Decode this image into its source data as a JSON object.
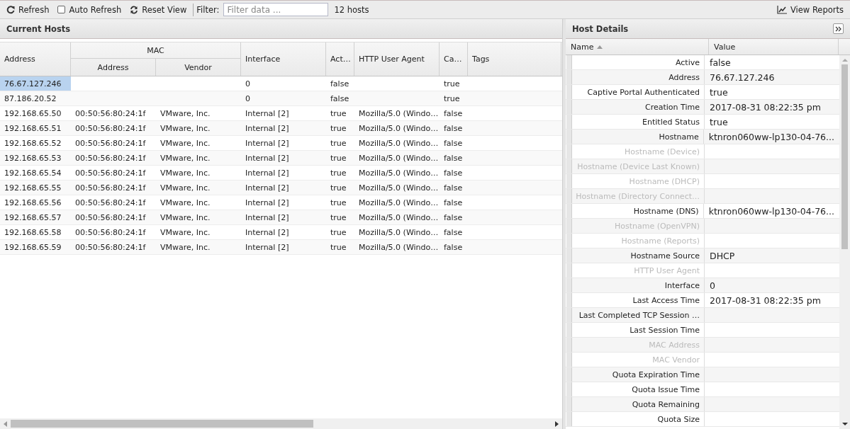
{
  "toolbar": {
    "refresh": "Refresh",
    "auto_refresh": {
      "label": "Auto Refresh",
      "checked": false
    },
    "reset_view": "Reset View",
    "filter_label": "Filter:",
    "filter": {
      "placeholder": "Filter data ..."
    },
    "count": "12 hosts",
    "view_reports": "View Reports"
  },
  "hosts_panel": {
    "title": "Current Hosts",
    "group_header": "MAC",
    "columns": [
      "Address",
      "Address",
      "Vendor",
      "Interface",
      "Act…",
      "HTTP User Agent",
      "Ca…",
      "Tags"
    ],
    "rows": [
      {
        "selected": true,
        "cells": [
          "76.67.127.246",
          "",
          "",
          "0",
          "false",
          "",
          "true",
          ""
        ]
      },
      {
        "selected": false,
        "cells": [
          "87.186.20.52",
          "",
          "",
          "0",
          "false",
          "",
          "true",
          ""
        ]
      },
      {
        "selected": false,
        "cells": [
          "192.168.65.50",
          "00:50:56:80:24:1f",
          "VMware, Inc.",
          "Internal [2]",
          "true",
          "Mozilla/5.0 (Windo…",
          "false",
          ""
        ]
      },
      {
        "selected": false,
        "cells": [
          "192.168.65.51",
          "00:50:56:80:24:1f",
          "VMware, Inc.",
          "Internal [2]",
          "true",
          "Mozilla/5.0 (Windo…",
          "false",
          ""
        ]
      },
      {
        "selected": false,
        "cells": [
          "192.168.65.52",
          "00:50:56:80:24:1f",
          "VMware, Inc.",
          "Internal [2]",
          "true",
          "Mozilla/5.0 (Windo…",
          "false",
          ""
        ]
      },
      {
        "selected": false,
        "cells": [
          "192.168.65.53",
          "00:50:56:80:24:1f",
          "VMware, Inc.",
          "Internal [2]",
          "true",
          "Mozilla/5.0 (Windo…",
          "false",
          ""
        ]
      },
      {
        "selected": false,
        "cells": [
          "192.168.65.54",
          "00:50:56:80:24:1f",
          "VMware, Inc.",
          "Internal [2]",
          "true",
          "Mozilla/5.0 (Windo…",
          "false",
          ""
        ]
      },
      {
        "selected": false,
        "cells": [
          "192.168.65.55",
          "00:50:56:80:24:1f",
          "VMware, Inc.",
          "Internal [2]",
          "true",
          "Mozilla/5.0 (Windo…",
          "false",
          ""
        ]
      },
      {
        "selected": false,
        "cells": [
          "192.168.65.56",
          "00:50:56:80:24:1f",
          "VMware, Inc.",
          "Internal [2]",
          "true",
          "Mozilla/5.0 (Windo…",
          "false",
          ""
        ]
      },
      {
        "selected": false,
        "cells": [
          "192.168.65.57",
          "00:50:56:80:24:1f",
          "VMware, Inc.",
          "Internal [2]",
          "true",
          "Mozilla/5.0 (Windo…",
          "false",
          ""
        ]
      },
      {
        "selected": false,
        "cells": [
          "192.168.65.58",
          "00:50:56:80:24:1f",
          "VMware, Inc.",
          "Internal [2]",
          "true",
          "Mozilla/5.0 (Windo…",
          "false",
          ""
        ]
      },
      {
        "selected": false,
        "cells": [
          "192.168.65.59",
          "00:50:56:80:24:1f",
          "VMware, Inc.",
          "Internal [2]",
          "true",
          "Mozilla/5.0 (Windo…",
          "false",
          ""
        ]
      }
    ]
  },
  "details_panel": {
    "title": "Host Details",
    "columns": [
      "Name",
      "Value"
    ],
    "rows": [
      {
        "name": "Active",
        "value": "false",
        "disabled": false
      },
      {
        "name": "Address",
        "value": "76.67.127.246",
        "disabled": false
      },
      {
        "name": "Captive Portal Authenticated",
        "value": "true",
        "disabled": false
      },
      {
        "name": "Creation Time",
        "value": "2017-08-31 08:22:35 pm",
        "disabled": false
      },
      {
        "name": "Entitled Status",
        "value": "true",
        "disabled": false
      },
      {
        "name": "Hostname",
        "value": "ktnron060ww-lp130-04-76...",
        "disabled": false
      },
      {
        "name": "Hostname (Device)",
        "disabled": true
      },
      {
        "name": "Hostname (Device Last Known)",
        "disabled": true
      },
      {
        "name": "Hostname (DHCP)",
        "disabled": true
      },
      {
        "name": "Hostname (Directory Connect…",
        "disabled": true
      },
      {
        "name": "Hostname (DNS)",
        "value": "ktnron060ww-lp130-04-76...",
        "disabled": false
      },
      {
        "name": "Hostname (OpenVPN)",
        "disabled": true
      },
      {
        "name": "Hostname (Reports)",
        "disabled": true
      },
      {
        "name": "Hostname Source",
        "value": "DHCP",
        "disabled": false
      },
      {
        "name": "HTTP User Agent",
        "disabled": true
      },
      {
        "name": "Interface",
        "value": "0",
        "disabled": false
      },
      {
        "name": "Last Access Time",
        "value": "2017-08-31 08:22:35 pm",
        "disabled": false
      },
      {
        "name": "Last Completed TCP Session …",
        "disabled": false
      },
      {
        "name": "Last Session Time",
        "disabled": false
      },
      {
        "name": "MAC Address",
        "disabled": true
      },
      {
        "name": "MAC Vendor",
        "disabled": true
      },
      {
        "name": "Quota Expiration Time",
        "disabled": false
      },
      {
        "name": "Quota Issue Time",
        "disabled": false
      },
      {
        "name": "Quota Remaining",
        "disabled": false
      },
      {
        "name": "Quota Size",
        "disabled": false
      }
    ]
  }
}
